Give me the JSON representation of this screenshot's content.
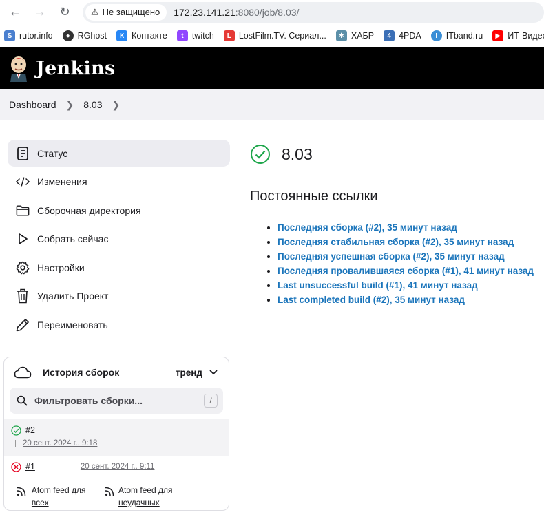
{
  "browser": {
    "security_label": "Не защищено",
    "url_host": "172.23.141.21",
    "url_rest": ":8080/job/8.03/"
  },
  "bookmarks": [
    {
      "label": "rutor.info",
      "icon": "rutor-icon",
      "color": "#4a7fcf"
    },
    {
      "label": "RGhost",
      "icon": "rghost-icon",
      "color": "#333333"
    },
    {
      "label": "Контакте",
      "icon": "vk-icon",
      "color": "#2787f5"
    },
    {
      "label": "twitch",
      "icon": "twitch-icon",
      "color": "#9146ff"
    },
    {
      "label": "LostFilm.TV. Сериал...",
      "icon": "lostfilm-icon",
      "color": "#e53935"
    },
    {
      "label": "ХАБР",
      "icon": "habr-icon",
      "color": "#5b8fa8"
    },
    {
      "label": "4PDA",
      "icon": "4pda-icon",
      "color": "#3b6fb6"
    },
    {
      "label": "ITband.ru",
      "icon": "itband-icon",
      "color": "#3a8ed6"
    },
    {
      "label": "ИТ-Видео -",
      "icon": "youtube-icon",
      "color": "#ff0000"
    }
  ],
  "header": {
    "title": "Jenkins"
  },
  "breadcrumb": {
    "dashboard": "Dashboard",
    "job": "8.03"
  },
  "sidebar": {
    "items": [
      {
        "label": "Статус",
        "icon": "document-icon"
      },
      {
        "label": "Изменения",
        "icon": "code-icon"
      },
      {
        "label": "Сборочная директория",
        "icon": "folder-icon"
      },
      {
        "label": "Собрать сейчас",
        "icon": "play-icon"
      },
      {
        "label": "Настройки",
        "icon": "gear-icon"
      },
      {
        "label": "Удалить Проект",
        "icon": "trash-icon"
      },
      {
        "label": "Переименовать",
        "icon": "pencil-icon"
      }
    ]
  },
  "history": {
    "title": "История сборок",
    "trend": "тренд",
    "filter_placeholder": "Фильтровать сборки...",
    "shortcut": "/",
    "builds": [
      {
        "number": "#2",
        "date": "20 сент. 2024 г., 9:18",
        "status": "success"
      },
      {
        "number": "#1",
        "date": "20 сент. 2024 г., 9:11",
        "status": "failed"
      }
    ],
    "feed_all": "Atom feed для всех",
    "feed_failed": "Atom feed для неудачных"
  },
  "main": {
    "job_name": "8.03",
    "permalinks_title": "Постоянные ссылки",
    "permalinks": [
      "Последняя сборка (#2), 35 минут назад",
      "Последняя стабильная сборка (#2), 35 минут назад",
      "Последняя успешная сборка (#2), 35 минут назад",
      "Последняя провалившаяся сборка (#1), 41 минут назад",
      "Last unsuccessful build (#1), 41 минут назад",
      "Last completed build (#2), 35 минут назад"
    ]
  },
  "colors": {
    "success": "#1ea64b",
    "failure": "#e6001f",
    "link": "#1b75bb"
  }
}
